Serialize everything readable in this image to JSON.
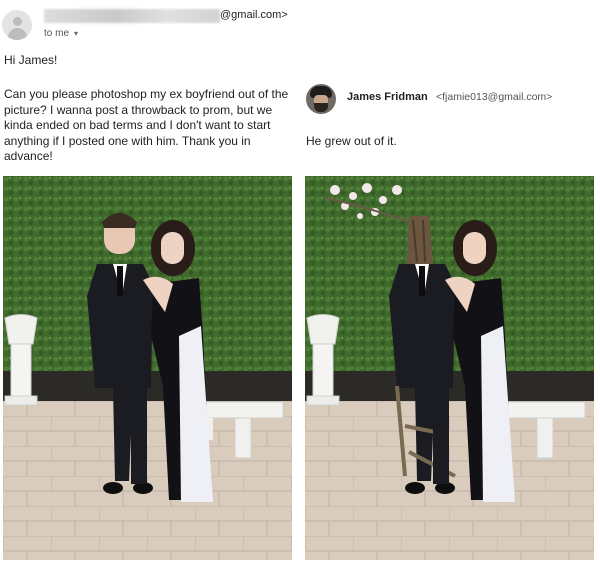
{
  "header": {
    "sender_domain": "@gmail.com>",
    "to_line": "to me",
    "to_caret": "▾"
  },
  "email": {
    "greeting": "Hi James!",
    "body": "Can you please photoshop my ex boyfriend out of the picture? I wanna post a throwback to prom, but we kinda ended on bad terms and I don't want to start anything if I posted one with him. Thank you in advance!"
  },
  "reply": {
    "name": "James Fridman",
    "email": "<fjamie013@gmail.com>",
    "text": "He grew out of it."
  },
  "colors": {
    "hedge": "#3f6a2c",
    "suit": "#1b1b22",
    "dress_white": "#eef0f6",
    "paving": "#d6c8b8"
  }
}
